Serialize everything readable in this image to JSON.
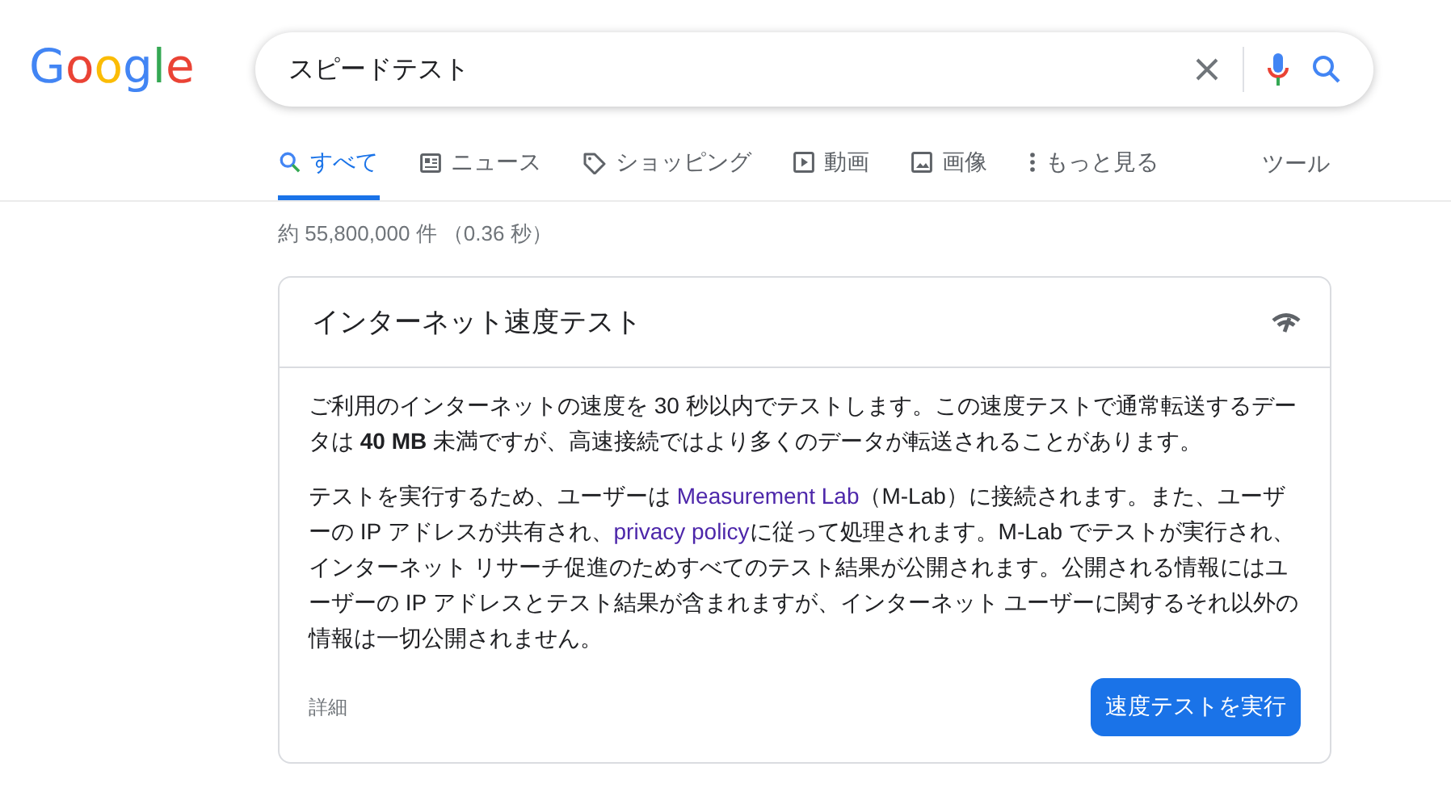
{
  "logo": "Google",
  "search": {
    "value": "スピードテスト"
  },
  "tabs": [
    {
      "label": "すべて",
      "kind": "search",
      "selected": true
    },
    {
      "label": "ニュース",
      "kind": "news",
      "selected": false
    },
    {
      "label": "ショッピング",
      "kind": "tag",
      "selected": false
    },
    {
      "label": "動画",
      "kind": "play",
      "selected": false
    },
    {
      "label": "画像",
      "kind": "image",
      "selected": false
    },
    {
      "label": "もっと見る",
      "kind": "more",
      "selected": false
    }
  ],
  "tools": "ツール",
  "result_stats": "約 55,800,000 件 （0.36 秒）",
  "card": {
    "title": "インターネット速度テスト",
    "intro": "ご利用のインターネットの速度を 30 秒以内でテストします。この速度テストで通常転送するデータは **40 MB** 未満ですが、高速接続ではより多くのデータが転送されることがあります。",
    "notice": [
      {
        "kind": "text",
        "text": "テストを実行するため、ユーザーは "
      },
      {
        "kind": "link",
        "text": "Measurement Lab"
      },
      {
        "kind": "text",
        "text": "（M-Lab）に接続されます。また、ユーザーの IP アドレスが共有され、"
      },
      {
        "kind": "link",
        "text": "privacy policy"
      },
      {
        "kind": "text",
        "text": "に従って処理されます。M-Lab でテストが実行され、インターネット リサーチ促進のためすべてのテスト結果が公開されます。公開される情報にはユーザーの IP アドレスとテスト結果が含まれますが、インターネット ユーザーに関するそれ以外の情報は一切公開されません。"
      }
    ],
    "details": "詳細",
    "run_button": "速度テストを実行"
  }
}
